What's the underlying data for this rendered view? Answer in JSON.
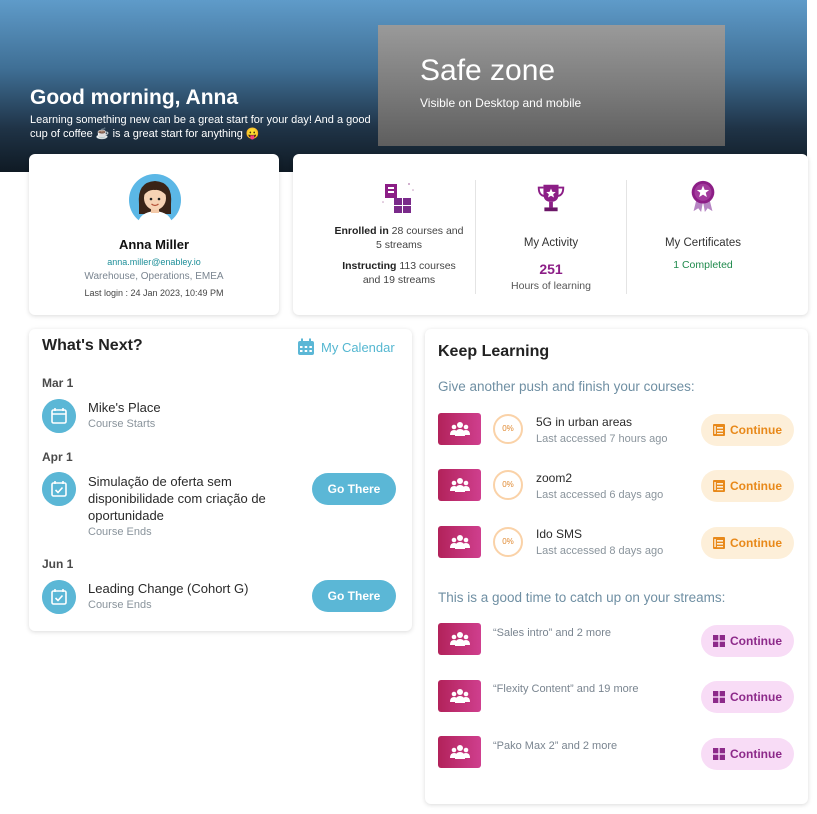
{
  "hero": {
    "greeting": "Good morning, Anna",
    "subtitle": "Learning something new can be a great start for your day! And a good cup of coffee ☕ is a great start for anything 😛",
    "safe_zone_title": "Safe zone",
    "safe_zone_subtitle": "Visible on Desktop and mobile"
  },
  "profile": {
    "name": "Anna Miller",
    "email": "anna.miller@enabley.io",
    "department": "Warehouse, Operations, EMEA",
    "last_login": "Last login : 24 Jan 2023, 10:49 PM"
  },
  "stats": {
    "enrolled_label": "Enrolled in",
    "enrolled_text1": " 28 courses and",
    "enrolled_text2": "5 streams",
    "instructing_label": "Instructing",
    "instructing_text1": " 113 courses",
    "instructing_text2": "and 19 streams",
    "activity_title": "My Activity",
    "activity_value": "251",
    "activity_unit": "Hours of learning",
    "certificates_title": "My Certificates",
    "certificates_value": "1 Completed"
  },
  "whats_next": {
    "title": "What's Next?",
    "calendar_link": "My Calendar",
    "events": [
      {
        "date": "Mar 1",
        "title": "Mike's Place",
        "subtitle": "Course Starts",
        "button": ""
      },
      {
        "date": "Apr 1",
        "title": "Simulação de oferta sem disponibilidade com criação de oportunidade",
        "subtitle": "Course Ends",
        "button": "Go There"
      },
      {
        "date": "Jun 1",
        "title": "Leading Change (Cohort G)",
        "subtitle": "Course Ends",
        "button": "Go There"
      }
    ]
  },
  "keep_learning": {
    "title": "Keep Learning",
    "courses_heading": "Give another push and finish your courses:",
    "courses": [
      {
        "title": "5G in urban areas",
        "last_accessed": "Last accessed 7 hours ago",
        "progress": "0%",
        "button": "Continue"
      },
      {
        "title": "zoom2",
        "last_accessed": "Last accessed 6 days ago",
        "progress": "0%",
        "button": "Continue"
      },
      {
        "title": "Ido SMS",
        "last_accessed": "Last accessed 8 days ago",
        "progress": "0%",
        "button": "Continue"
      }
    ],
    "streams_heading": "This is a good time to catch up on your streams:",
    "streams": [
      {
        "title": "“Sales intro” and 2 more",
        "button": "Continue"
      },
      {
        "title": "“Flexity Content” and 19 more",
        "button": "Continue"
      },
      {
        "title": "“Pako Max 2” and 2 more",
        "button": "Continue"
      }
    ]
  },
  "colors": {
    "accent_blue": "#5bb7d6",
    "brand_purple": "#8c1e86",
    "course_button_bg": "#fdefd9",
    "stream_button_bg": "#f8dcf6"
  }
}
